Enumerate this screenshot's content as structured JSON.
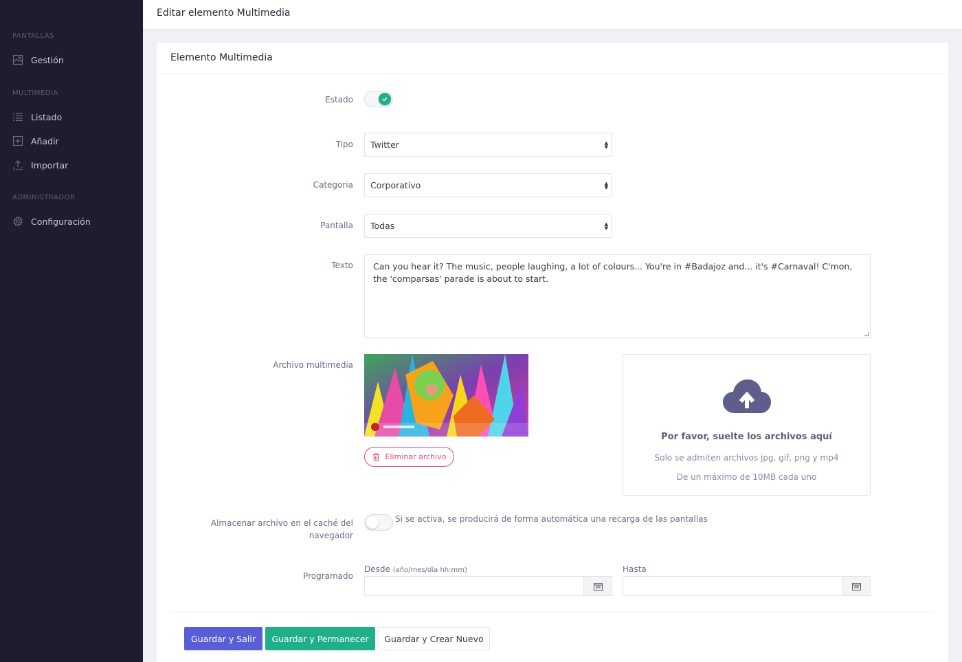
{
  "sidebar": {
    "sections": [
      {
        "title": "PANTALLAS",
        "items": [
          {
            "label": "Gestión",
            "icon": "image-icon"
          }
        ]
      },
      {
        "title": "MULTIMEDIA",
        "items": [
          {
            "label": "Listado",
            "icon": "list-icon"
          },
          {
            "label": "Añadir",
            "icon": "plus-square-icon"
          },
          {
            "label": "Importar",
            "icon": "upload-icon"
          }
        ]
      },
      {
        "title": "ADMINISTRADOR",
        "items": [
          {
            "label": "Configuración",
            "icon": "gear-icon"
          }
        ]
      }
    ]
  },
  "topbar": {
    "title": "Editar elemento Multimedia"
  },
  "card": {
    "title": "Elemento Multimedia"
  },
  "form": {
    "estado": {
      "label": "Estado",
      "enabled": true
    },
    "tipo": {
      "label": "Tipo",
      "value": "Twitter"
    },
    "categoria": {
      "label": "Categoria",
      "value": "Corporativo"
    },
    "pantalla": {
      "label": "Pantalla",
      "value": "Todas"
    },
    "texto": {
      "label": "Texto",
      "value": "Can you hear it? The music, people laughing, a lot of colours... You're in #Badajoz and... it's #Carnaval! C'mon, the 'comparsas' parade is about to start."
    },
    "archivo": {
      "label": "Archivo multimedia",
      "delete_label": "Eliminar archivo",
      "dropzone_title": "Por favor, suelte los archivos aquí",
      "dropzone_sub1": "Solo se admiten archivos jpg, gif, png y mp4",
      "dropzone_sub2": "De un máximo de 10MB cada uno"
    },
    "cache": {
      "label_line1": "Almacenar archivo en el caché del",
      "label_line2": "navegador",
      "enabled": false,
      "help": "Si se activa, se producirá de forma automática una recarga de las pantallas"
    },
    "programado": {
      "label": "Programado",
      "desde_label": "Desde",
      "desde_hint": "(año/mes/día hh:mm)",
      "hasta_label": "Hasta",
      "desde_value": "",
      "hasta_value": ""
    }
  },
  "actions": {
    "save_exit": "Guardar y Salir",
    "save_stay": "Guardar y Permanecer",
    "save_new": "Guardar y Crear Nuevo"
  },
  "colors": {
    "sidebar_bg": "#1e1c2e",
    "primary": "#5a5ed6",
    "success": "#1fb08a",
    "danger": "#e5497a"
  }
}
